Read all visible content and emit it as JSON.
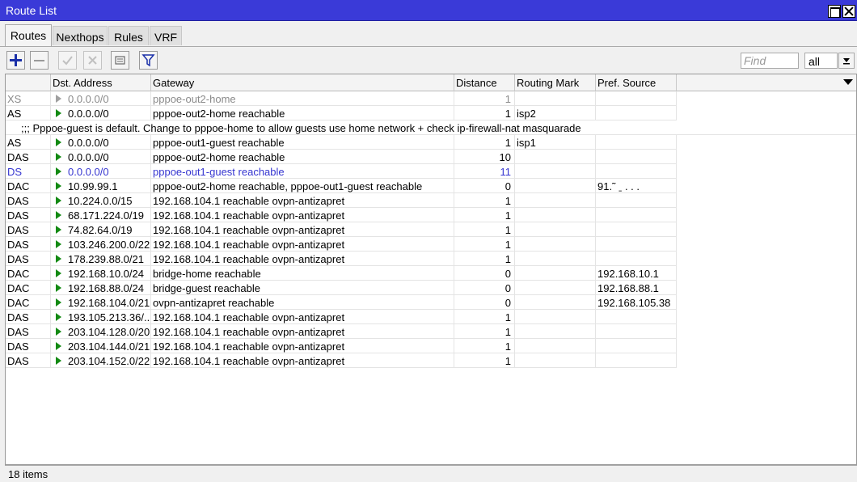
{
  "window": {
    "title": "Route List"
  },
  "tabs": [
    {
      "label": "Routes"
    },
    {
      "label": "Nexthops"
    },
    {
      "label": "Rules"
    },
    {
      "label": "VRF"
    }
  ],
  "toolbar": {
    "find_placeholder": "Find",
    "filter_value": "all"
  },
  "table": {
    "columns": [
      "",
      "Dst. Address",
      "Gateway",
      "Distance",
      "Routing Mark",
      "Pref. Source"
    ],
    "comment": ";;; Pppoe-guest is default. Change to pppoe-home to allow guests use home network + check ip-firewall-nat masquarade",
    "rows": [
      {
        "flags": "XS",
        "dst": "0.0.0.0/0",
        "gateway": "pppoe-out2-home",
        "distance": "1",
        "mark": "",
        "pref": ""
      },
      {
        "flags": "AS",
        "dst": "0.0.0.0/0",
        "gateway": "pppoe-out2-home reachable",
        "distance": "1",
        "mark": "isp2",
        "pref": ""
      },
      {
        "flags": "AS",
        "dst": "0.0.0.0/0",
        "gateway": "pppoe-out1-guest reachable",
        "distance": "1",
        "mark": "isp1",
        "pref": ""
      },
      {
        "flags": "DAS",
        "dst": "0.0.0.0/0",
        "gateway": "pppoe-out2-home reachable",
        "distance": "10",
        "mark": "",
        "pref": ""
      },
      {
        "flags": "DS",
        "dst": "0.0.0.0/0",
        "gateway": "pppoe-out1-guest reachable",
        "distance": "11",
        "mark": "",
        "pref": ""
      },
      {
        "flags": "DAC",
        "dst": "10.99.99.1",
        "gateway": "pppoe-out2-home reachable, pppoe-out1-guest reachable",
        "distance": "0",
        "mark": "",
        "pref": "91.˜ ˍ . . ."
      },
      {
        "flags": "DAS",
        "dst": "10.224.0.0/15",
        "gateway": "192.168.104.1 reachable ovpn-antizapret",
        "distance": "1",
        "mark": "",
        "pref": ""
      },
      {
        "flags": "DAS",
        "dst": "68.171.224.0/19",
        "gateway": "192.168.104.1 reachable ovpn-antizapret",
        "distance": "1",
        "mark": "",
        "pref": ""
      },
      {
        "flags": "DAS",
        "dst": "74.82.64.0/19",
        "gateway": "192.168.104.1 reachable ovpn-antizapret",
        "distance": "1",
        "mark": "",
        "pref": ""
      },
      {
        "flags": "DAS",
        "dst": "103.246.200.0/22",
        "gateway": "192.168.104.1 reachable ovpn-antizapret",
        "distance": "1",
        "mark": "",
        "pref": ""
      },
      {
        "flags": "DAS",
        "dst": "178.239.88.0/21",
        "gateway": "192.168.104.1 reachable ovpn-antizapret",
        "distance": "1",
        "mark": "",
        "pref": ""
      },
      {
        "flags": "DAC",
        "dst": "192.168.10.0/24",
        "gateway": "bridge-home reachable",
        "distance": "0",
        "mark": "",
        "pref": "192.168.10.1"
      },
      {
        "flags": "DAC",
        "dst": "192.168.88.0/24",
        "gateway": "bridge-guest reachable",
        "distance": "0",
        "mark": "",
        "pref": "192.168.88.1"
      },
      {
        "flags": "DAC",
        "dst": "192.168.104.0/21",
        "gateway": "ovpn-antizapret reachable",
        "distance": "0",
        "mark": "",
        "pref": "192.168.105.38"
      },
      {
        "flags": "DAS",
        "dst": "193.105.213.36/...",
        "gateway": "192.168.104.1 reachable ovpn-antizapret",
        "distance": "1",
        "mark": "",
        "pref": ""
      },
      {
        "flags": "DAS",
        "dst": "203.104.128.0/20",
        "gateway": "192.168.104.1 reachable ovpn-antizapret",
        "distance": "1",
        "mark": "",
        "pref": ""
      },
      {
        "flags": "DAS",
        "dst": "203.104.144.0/21",
        "gateway": "192.168.104.1 reachable ovpn-antizapret",
        "distance": "1",
        "mark": "",
        "pref": ""
      },
      {
        "flags": "DAS",
        "dst": "203.104.152.0/22",
        "gateway": "192.168.104.1 reachable ovpn-antizapret",
        "distance": "1",
        "mark": "",
        "pref": ""
      }
    ]
  },
  "status": {
    "text": "18 items"
  },
  "colors": {
    "titlebar": "#3a3ad8",
    "active_route_arrow": "#138a13",
    "disabled_text": "#8a8a8a",
    "inactive_text": "#3535d0"
  }
}
